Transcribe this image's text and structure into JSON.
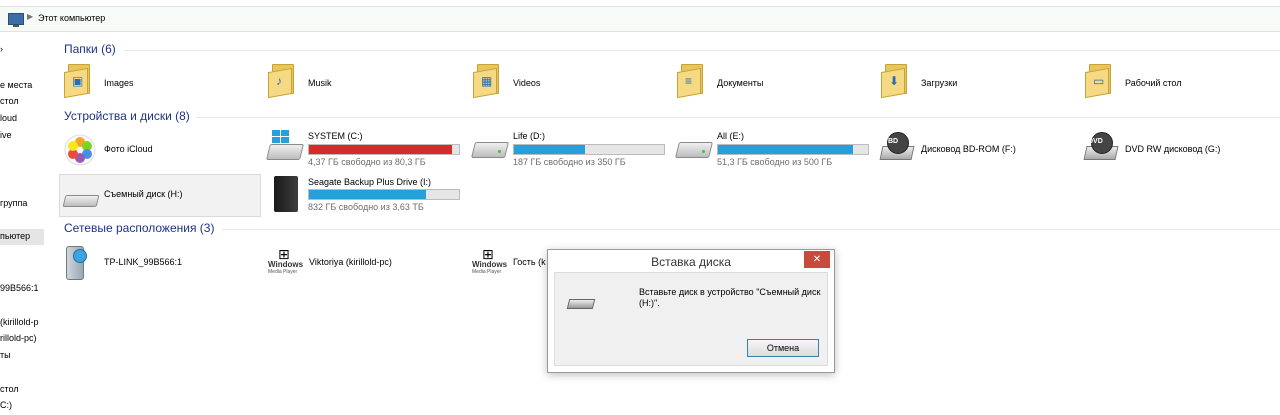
{
  "address": {
    "crumb": "Этот компьютер"
  },
  "sidebar": {
    "items": [
      "е места",
      "стол",
      "loud",
      "ive",
      "группа",
      "пьютер",
      "99B566:1",
      "(kirillold-p",
      "rillold-pc)",
      "ты",
      "стол",
      "C:)"
    ]
  },
  "sections": {
    "folders": "Папки (6)",
    "devices": "Устройства и диски (8)",
    "network": "Сетевые расположения (3)"
  },
  "folders": [
    {
      "label": "Images",
      "icon": "pictures-folder-icon"
    },
    {
      "label": "Musik",
      "icon": "music-folder-icon"
    },
    {
      "label": "Videos",
      "icon": "videos-folder-icon"
    },
    {
      "label": "Документы",
      "icon": "documents-folder-icon"
    },
    {
      "label": "Загрузки",
      "icon": "downloads-folder-icon"
    },
    {
      "label": "Рабочий стол",
      "icon": "desktop-folder-icon"
    }
  ],
  "devices": {
    "icloud": {
      "label": "Фото iCloud"
    },
    "drives": [
      {
        "label": "SYSTEM (C:)",
        "free": "4,37 ГБ свободно из 80,3 ГБ",
        "used_fraction": 0.95,
        "color": "#d62b2b"
      },
      {
        "label": "Life (D:)",
        "free": "187 ГБ свободно из 350 ГБ",
        "used_fraction": 0.47,
        "color": "#26a0da"
      },
      {
        "label": "All (E:)",
        "free": "51,3 ГБ свободно из 500 ГБ",
        "used_fraction": 0.9,
        "color": "#26a0da"
      }
    ],
    "bdrom": {
      "label": "Дисковод BD-ROM (F:)",
      "tag": "BD"
    },
    "dvd": {
      "label": "DVD RW дисковод (G:)",
      "tag": "DVD"
    },
    "removable": {
      "label": "Съемный диск (H:)"
    },
    "seagate": {
      "label": "Seagate Backup Plus Drive (I:)",
      "free": "832 ГБ свободно из 3,63 ТБ",
      "used_fraction": 0.78,
      "color": "#26a0da"
    }
  },
  "network": [
    {
      "label": "TP-LINK_99B566:1"
    },
    {
      "label": "Viktoriya (kirillold-pc)",
      "brand1": "Windows",
      "brand2": "Media Player"
    },
    {
      "label": "Гость (k",
      "brand1": "Windows",
      "brand2": "Media Player"
    }
  ],
  "dialog": {
    "title": "Вставка диска",
    "close": "✕",
    "message": "Вставьте диск в устройство \"Съемный диск (H:)\".",
    "cancel": "Отмена"
  }
}
